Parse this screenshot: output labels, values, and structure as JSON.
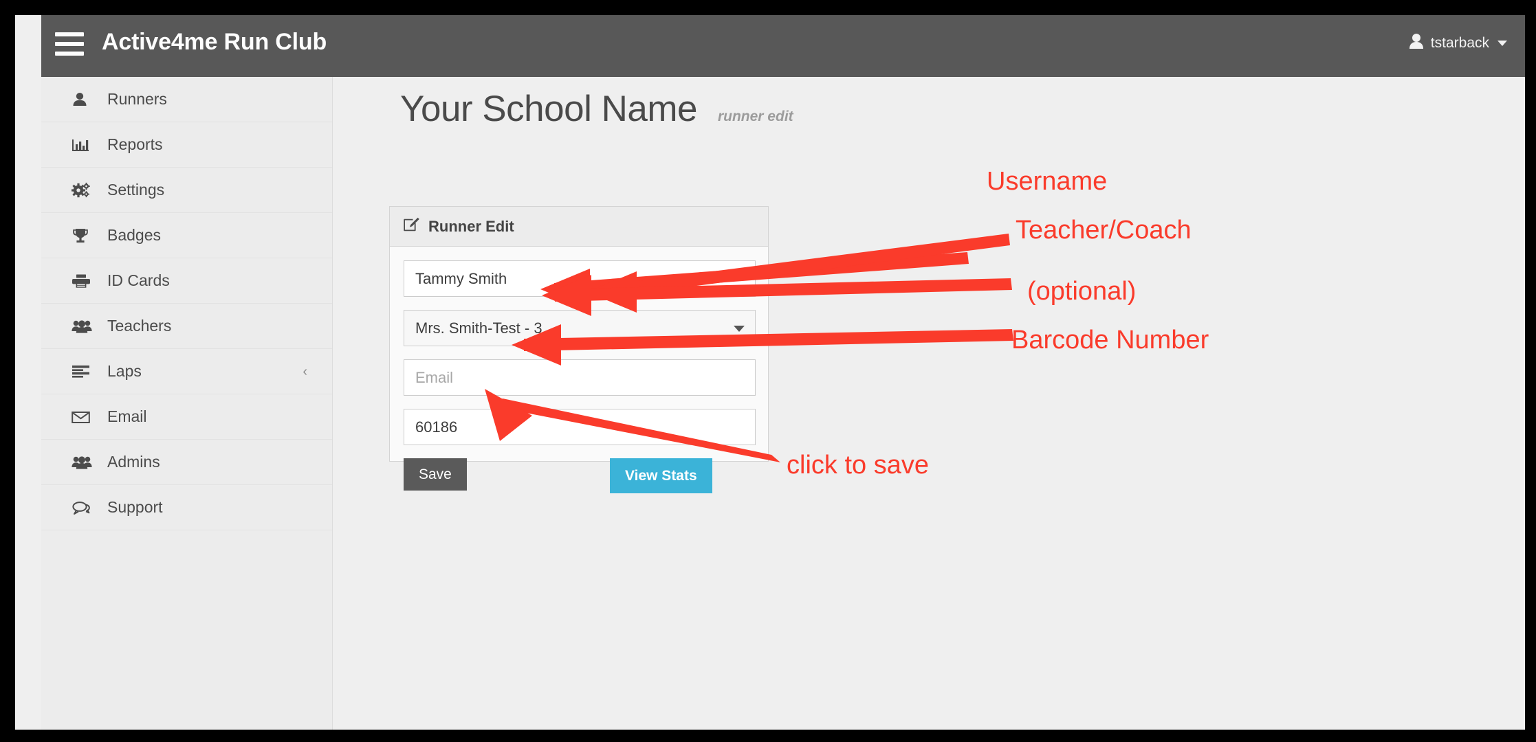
{
  "app": {
    "brand": "Active4me Run Club",
    "menu_icon": "hamburger-icon"
  },
  "user": {
    "name": "tstarback",
    "avatar_icon": "user-icon",
    "caret_icon": "caret-down-icon"
  },
  "sidebar": {
    "items": [
      {
        "label": "Runners",
        "icon": "user-icon",
        "chevron": ""
      },
      {
        "label": "Reports",
        "icon": "bar-chart-icon",
        "chevron": ""
      },
      {
        "label": "Settings",
        "icon": "gears-icon",
        "chevron": ""
      },
      {
        "label": "Badges",
        "icon": "trophy-icon",
        "chevron": ""
      },
      {
        "label": "ID Cards",
        "icon": "printer-icon",
        "chevron": ""
      },
      {
        "label": "Teachers",
        "icon": "users-icon",
        "chevron": ""
      },
      {
        "label": "Laps",
        "icon": "list-icon",
        "chevron": "‹"
      },
      {
        "label": "Email",
        "icon": "envelope-icon",
        "chevron": ""
      },
      {
        "label": "Admins",
        "icon": "users-icon",
        "chevron": ""
      },
      {
        "label": "Support",
        "icon": "comments-icon",
        "chevron": ""
      }
    ]
  },
  "page": {
    "title": "Your School Name",
    "subtitle": "runner edit"
  },
  "panel": {
    "title": "Runner Edit",
    "icon": "edit-pencil-square-icon",
    "fields": {
      "username": {
        "value": "Tammy Smith",
        "placeholder": "Username"
      },
      "teacher": {
        "value": "Mrs. Smith-Test - 3"
      },
      "email": {
        "value": "",
        "placeholder": "Email"
      },
      "barcode": {
        "value": "60186",
        "placeholder": "Barcode Number"
      }
    },
    "buttons": {
      "save": "Save",
      "view_stats": "View Stats"
    }
  },
  "annotations": {
    "color": "#fa3b2b",
    "items": [
      {
        "text": "Username"
      },
      {
        "text": "Teacher/Coach"
      },
      {
        "text": "(optional)"
      },
      {
        "text": "Barcode Number"
      },
      {
        "text": "click to save"
      }
    ]
  },
  "colors": {
    "navbar": "#585858",
    "sidebar": "#ececec",
    "content": "#efefef",
    "save_button": "#5a5a5a",
    "view_stats_button": "#3bb3d8",
    "annotation_red": "#fa3b2b"
  }
}
